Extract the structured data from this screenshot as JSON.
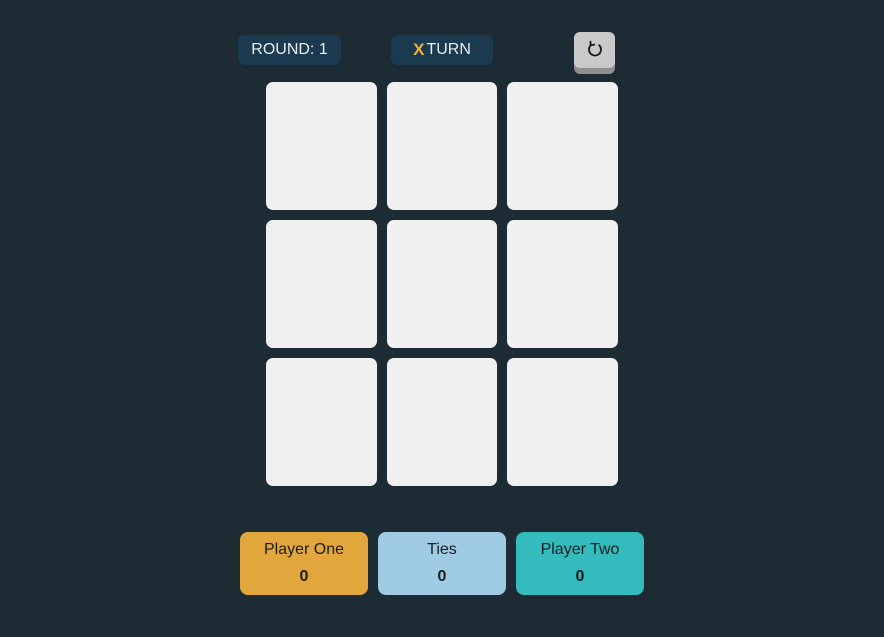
{
  "header": {
    "round_label": "ROUND: 1",
    "turn_mark": "X",
    "turn_label": "TURN",
    "reset_icon": "restart-icon"
  },
  "board": {
    "cells": [
      "",
      "",
      "",
      "",
      "",
      "",
      "",
      "",
      ""
    ]
  },
  "scores": {
    "player_one": {
      "label": "Player One",
      "value": "0",
      "color": "#e1a73d"
    },
    "ties": {
      "label": "Ties",
      "value": "0",
      "color": "#a0cbe4"
    },
    "player_two": {
      "label": "Player Two",
      "value": "0",
      "color": "#33bbbd"
    }
  },
  "colors": {
    "background": "#1d2b34",
    "pill": "#1b3a4f",
    "x_accent": "#f2b33d",
    "cell": "#f0f0f0"
  }
}
